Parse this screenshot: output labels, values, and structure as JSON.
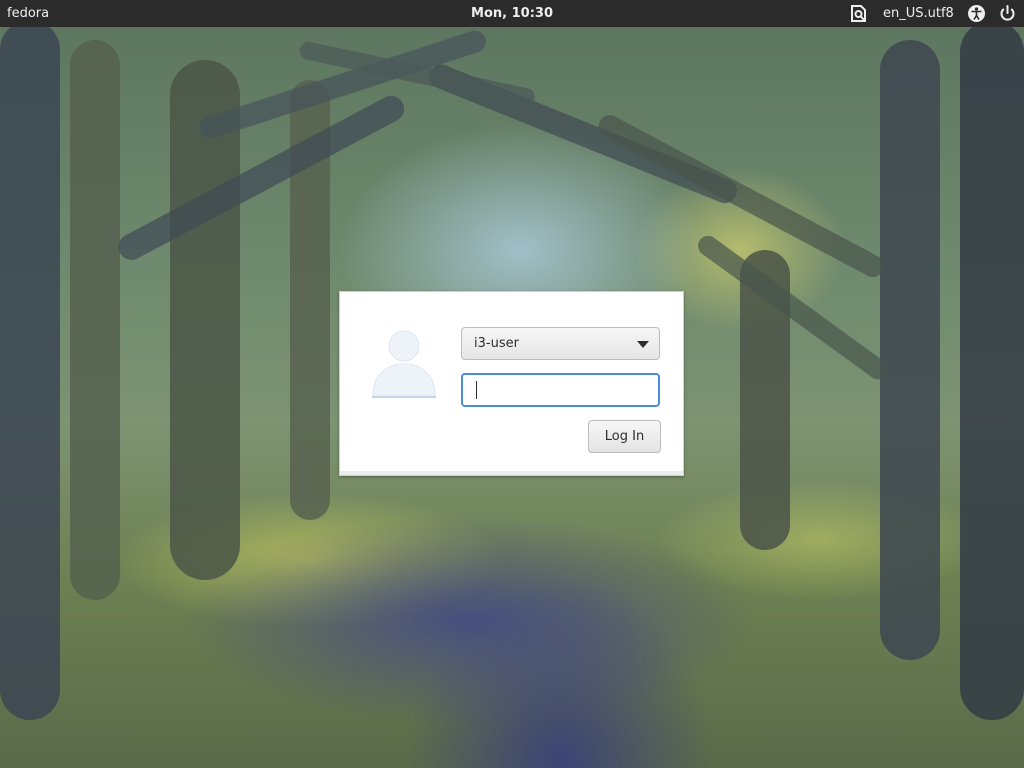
{
  "topbar": {
    "hostname": "fedora",
    "clock": "Mon, 10:30",
    "locale": "en_US.utf8",
    "icons": [
      "orca-screen-reader-icon",
      "accessibility-icon",
      "power-icon"
    ]
  },
  "login": {
    "selected_user": "i3-user",
    "password_value": "",
    "login_button_label": "Log In"
  },
  "colors": {
    "topbar": "#2b2b2b",
    "focus_border": "#4a90d9",
    "dialog": "#ffffff"
  }
}
